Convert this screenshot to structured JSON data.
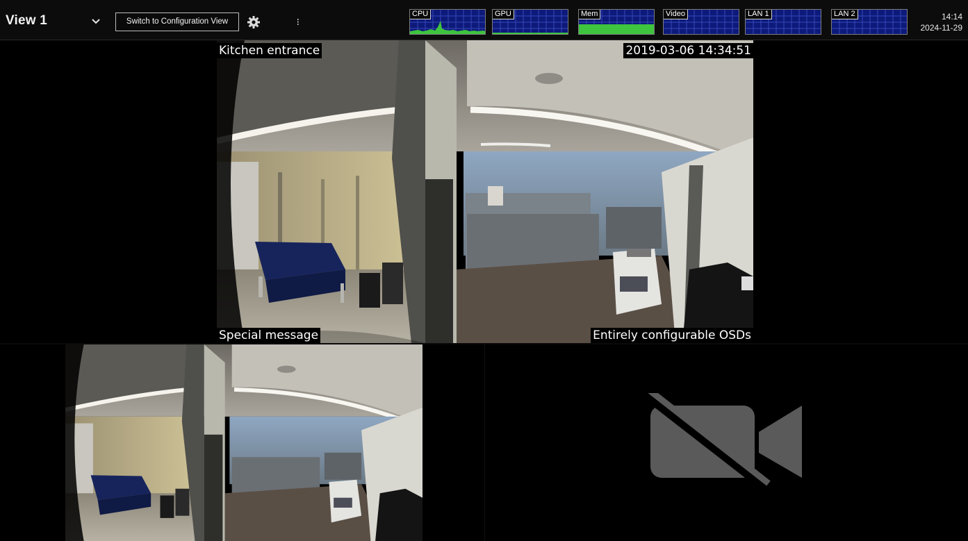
{
  "header": {
    "view_title": "View 1",
    "dropdown_icon": "chevron-down-icon",
    "switch_button_label": "Switch to Configuration View",
    "settings_icon": "gear-icon",
    "more_icon": "vertical-ellipsis-icon",
    "clock": {
      "time": "14:14",
      "date": "2024-11-29"
    }
  },
  "meters": [
    {
      "label": "CPU"
    },
    {
      "label": "GPU"
    },
    {
      "label": "Mem"
    },
    {
      "label": "Video"
    },
    {
      "label": "LAN 1"
    },
    {
      "label": "LAN 2"
    }
  ],
  "panes": {
    "main": {
      "osd_top_left": "Kitchen entrance",
      "osd_top_right": "2019-03-06 14:34:51",
      "osd_bottom_left": "Special message",
      "osd_bottom_right": "Entirely configurable OSDs"
    },
    "empty_slot_icon": "camera-off-icon"
  },
  "colors": {
    "meter_background": "#0d1a7a",
    "meter_activity": "#3ec43e",
    "nocam_icon": "#5a5a5a"
  }
}
